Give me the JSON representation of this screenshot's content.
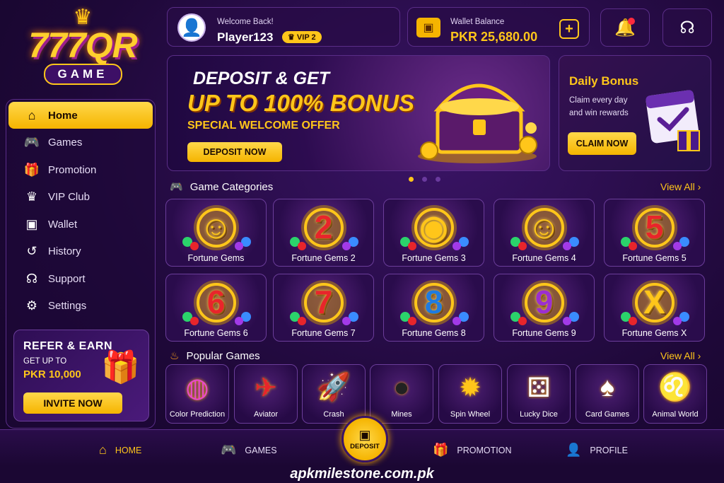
{
  "logo": {
    "crown": "♛",
    "main": "777QR",
    "sub": "GAME"
  },
  "sidebar": {
    "items": [
      {
        "label": "Home",
        "icon": "home-icon",
        "active": true
      },
      {
        "label": "Games",
        "icon": "gamepad-icon"
      },
      {
        "label": "Promotion",
        "icon": "gift-icon"
      },
      {
        "label": "VIP Club",
        "icon": "crown-icon"
      },
      {
        "label": "Wallet",
        "icon": "wallet-icon"
      },
      {
        "label": "History",
        "icon": "history-icon"
      },
      {
        "label": "Support",
        "icon": "headset-icon"
      },
      {
        "label": "Settings",
        "icon": "gear-icon"
      }
    ],
    "refer": {
      "title": "REFER & EARN",
      "get_up_to": "GET UP TO",
      "amount": "PKR 10,000",
      "button": "INVITE NOW"
    }
  },
  "user": {
    "welcome": "Welcome Back!",
    "name": "Player123",
    "vip": "VIP 2"
  },
  "wallet": {
    "label": "Wallet Balance",
    "value": "PKR 25,680.00",
    "add": "+"
  },
  "banner": {
    "line1": "DEPOSIT & GET",
    "line2": "UP TO 100% BONUS",
    "line3": "SPECIAL WELCOME OFFER",
    "button": "DEPOSIT NOW"
  },
  "daily": {
    "title": "Daily Bonus",
    "desc": "Claim every day and win rewards",
    "button": "CLAIM NOW"
  },
  "categories": {
    "title": "Game Categories",
    "view_all": "View All",
    "items": [
      {
        "name": "Fortune Gems",
        "glyph": "☺"
      },
      {
        "name": "Fortune Gems 2",
        "glyph": "2"
      },
      {
        "name": "Fortune Gems 3",
        "glyph": "◉"
      },
      {
        "name": "Fortune Gems 4",
        "glyph": "☺"
      },
      {
        "name": "Fortune Gems 5",
        "glyph": "5"
      },
      {
        "name": "Fortune Gems 6",
        "glyph": "6"
      },
      {
        "name": "Fortune Gems 7",
        "glyph": "7"
      },
      {
        "name": "Fortune Gems 8",
        "glyph": "8"
      },
      {
        "name": "Fortune Gems 9",
        "glyph": "9"
      },
      {
        "name": "Fortune Gems X",
        "glyph": "X"
      }
    ]
  },
  "popular": {
    "title": "Popular Games",
    "view_all": "View All",
    "items": [
      {
        "name": "Color Prediction",
        "glyph": "◍"
      },
      {
        "name": "Aviator",
        "glyph": "✈"
      },
      {
        "name": "Crash",
        "glyph": "🚀"
      },
      {
        "name": "Mines",
        "glyph": "●"
      },
      {
        "name": "Spin Wheel",
        "glyph": "✹"
      },
      {
        "name": "Lucky Dice",
        "glyph": "⚄"
      },
      {
        "name": "Card Games",
        "glyph": "♠"
      },
      {
        "name": "Animal World",
        "glyph": "♌"
      }
    ]
  },
  "bottom_nav": [
    {
      "label": "HOME",
      "active": true
    },
    {
      "label": "GAMES"
    },
    {
      "label": "DEPOSIT"
    },
    {
      "label": "PROMOTION"
    },
    {
      "label": "PROFILE"
    }
  ],
  "footer": "apkmilestone.com.pk",
  "colors": {
    "accent": "#ffc61a",
    "background": "#1e0838",
    "notification": "#ff2a3d"
  }
}
